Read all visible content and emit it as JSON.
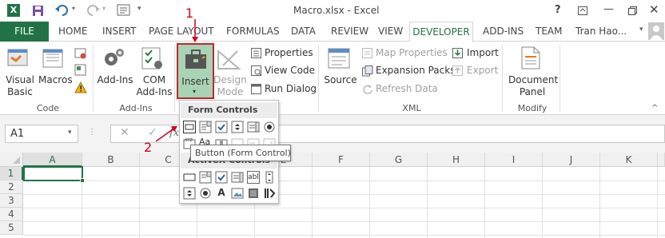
{
  "window": {
    "title": "Macro.xlsx - Excel",
    "user": "Tran Hao..."
  },
  "tabs": {
    "file": "FILE",
    "home": "HOME",
    "insert": "INSERT",
    "page_layout": "PAGE LAYOUT",
    "formulas": "FORMULAS",
    "data": "DATA",
    "review": "REVIEW",
    "view": "VIEW",
    "developer": "DEVELOPER",
    "add_ins": "ADD-INS",
    "team": "TEAM"
  },
  "ribbon": {
    "code": {
      "label": "Code",
      "visual_basic": [
        "Visual",
        "Basic"
      ],
      "macros": "Macros"
    },
    "add_ins": {
      "label": "Add-Ins",
      "add_ins": "Add-Ins",
      "com_add_ins": [
        "COM",
        "Add-Ins"
      ]
    },
    "controls": {
      "insert": "Insert",
      "design_mode": [
        "Design",
        "Mode"
      ],
      "properties": "Properties",
      "view_code": "View Code",
      "run_dialog": "Run Dialog"
    },
    "xml": {
      "label": "XML",
      "source": "Source",
      "map_properties": "Map Properties",
      "expansion_packs": "Expansion Packs",
      "refresh_data": "Refresh Data",
      "import": "Import",
      "export": "Export"
    },
    "modify": {
      "label": "Modify",
      "document_panel": [
        "Document",
        "Panel"
      ]
    }
  },
  "formula_bar": {
    "name_box": "A1",
    "fx": "fx"
  },
  "dropdown": {
    "form_controls": "Form Controls",
    "activex_controls": "ActiveX Controls",
    "tooltip": "Button (Form Control)"
  },
  "sheet": {
    "columns": [
      "A",
      "B",
      "C",
      "D",
      "E",
      "F",
      "G",
      "H",
      "I",
      "J",
      "K"
    ],
    "rows": [
      "1",
      "2",
      "3",
      "4",
      "5"
    ],
    "active_cell": "A1"
  },
  "annotations": {
    "step1": "1",
    "step2": "2"
  },
  "colors": {
    "excel_green": "#217346",
    "selection_green": "#a9d3b5",
    "highlight_border": "#c0282b",
    "annotation": "#d0021b"
  }
}
